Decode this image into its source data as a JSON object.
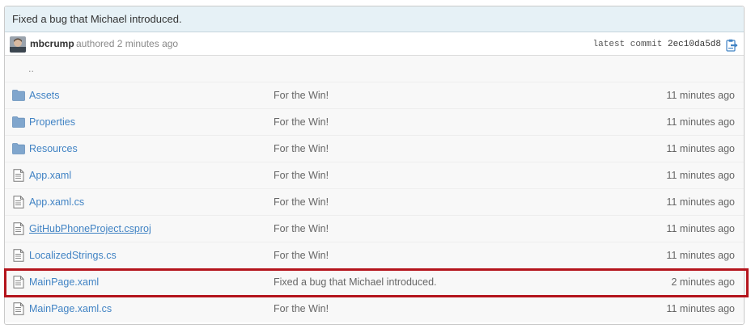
{
  "commit": {
    "title": "Fixed a bug that Michael introduced.",
    "author": "mbcrump",
    "authored_text": "authored 2 minutes ago",
    "latest_label": "latest commit",
    "hash": "2ec10da5d8"
  },
  "parent_dir": "..",
  "files": [
    {
      "type": "folder",
      "name": "Assets",
      "message": "For the Win!",
      "age": "11 minutes ago"
    },
    {
      "type": "folder",
      "name": "Properties",
      "message": "For the Win!",
      "age": "11 minutes ago"
    },
    {
      "type": "folder",
      "name": "Resources",
      "message": "For the Win!",
      "age": "11 minutes ago"
    },
    {
      "type": "file",
      "name": "App.xaml",
      "message": "For the Win!",
      "age": "11 minutes ago"
    },
    {
      "type": "file",
      "name": "App.xaml.cs",
      "message": "For the Win!",
      "age": "11 minutes ago"
    },
    {
      "type": "file",
      "name": "GitHubPhoneProject.csproj",
      "message": "For the Win!",
      "age": "11 minutes ago"
    },
    {
      "type": "file",
      "name": "LocalizedStrings.cs",
      "message": "For the Win!",
      "age": "11 minutes ago"
    },
    {
      "type": "file",
      "name": "MainPage.xaml",
      "message": "Fixed a bug that Michael introduced.",
      "age": "2 minutes ago"
    },
    {
      "type": "file",
      "name": "MainPage.xaml.cs",
      "message": "For the Win!",
      "age": "11 minutes ago"
    }
  ],
  "colors": {
    "link": "#4183c4",
    "header_bg": "#e6f1f6",
    "highlight_border": "#b4141c",
    "folder_icon": "#80a6cd"
  }
}
